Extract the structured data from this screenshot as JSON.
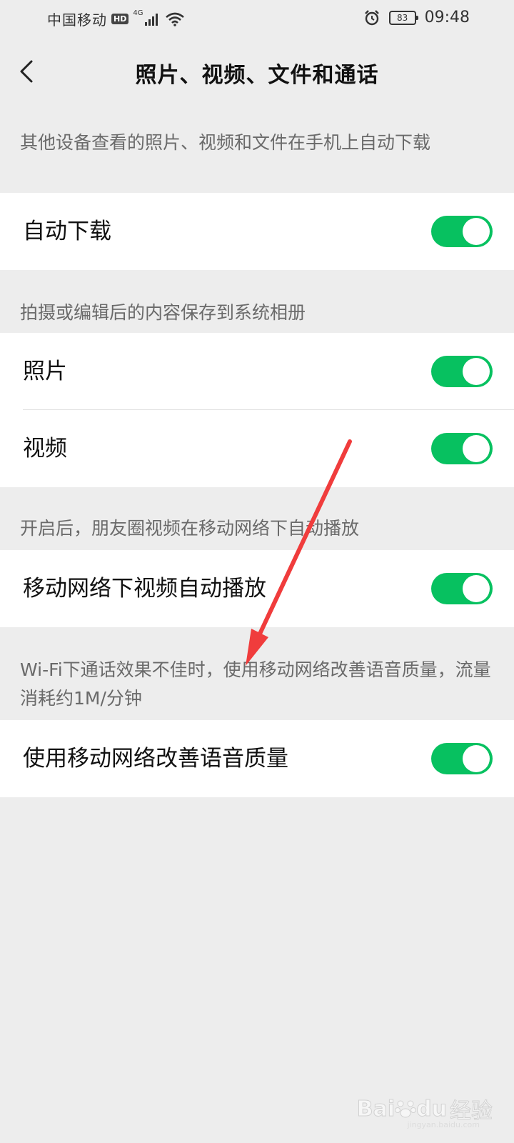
{
  "status_bar": {
    "carrier": "中国移动",
    "hd_badge": "HD",
    "network_type": "4G",
    "battery_level": "83",
    "time": "09:48",
    "icons": [
      "signal-icon",
      "wifi-icon",
      "alarm-icon",
      "battery-icon"
    ]
  },
  "header": {
    "title": "照片、视频、文件和通话",
    "back_icon": "back-chevron-icon"
  },
  "sections": [
    {
      "description": "其他设备查看的照片、视频和文件在手机上自动下载",
      "rows": [
        {
          "label": "自动下载",
          "enabled": true
        }
      ]
    },
    {
      "description": "拍摄或编辑后的内容保存到系统相册",
      "rows": [
        {
          "label": "照片",
          "enabled": true
        },
        {
          "label": "视频",
          "enabled": true
        }
      ]
    },
    {
      "description": "开启后，朋友圈视频在移动网络下自动播放",
      "rows": [
        {
          "label": "移动网络下视频自动播放",
          "enabled": true
        }
      ]
    },
    {
      "description": "Wi-Fi下通话效果不佳时，使用移动网络改善语音质量，流量消耗约1M/分钟",
      "rows": [
        {
          "label": "使用移动网络改善语音质量",
          "enabled": true
        }
      ]
    }
  ],
  "colors": {
    "toggle_on": "#07c160",
    "background": "#ededed",
    "annotation_arrow": "#f03c3c"
  },
  "watermark": {
    "brand": "Bai",
    "brand_suffix": "du",
    "label": "经验",
    "url": "jingyan.baidu.com"
  }
}
